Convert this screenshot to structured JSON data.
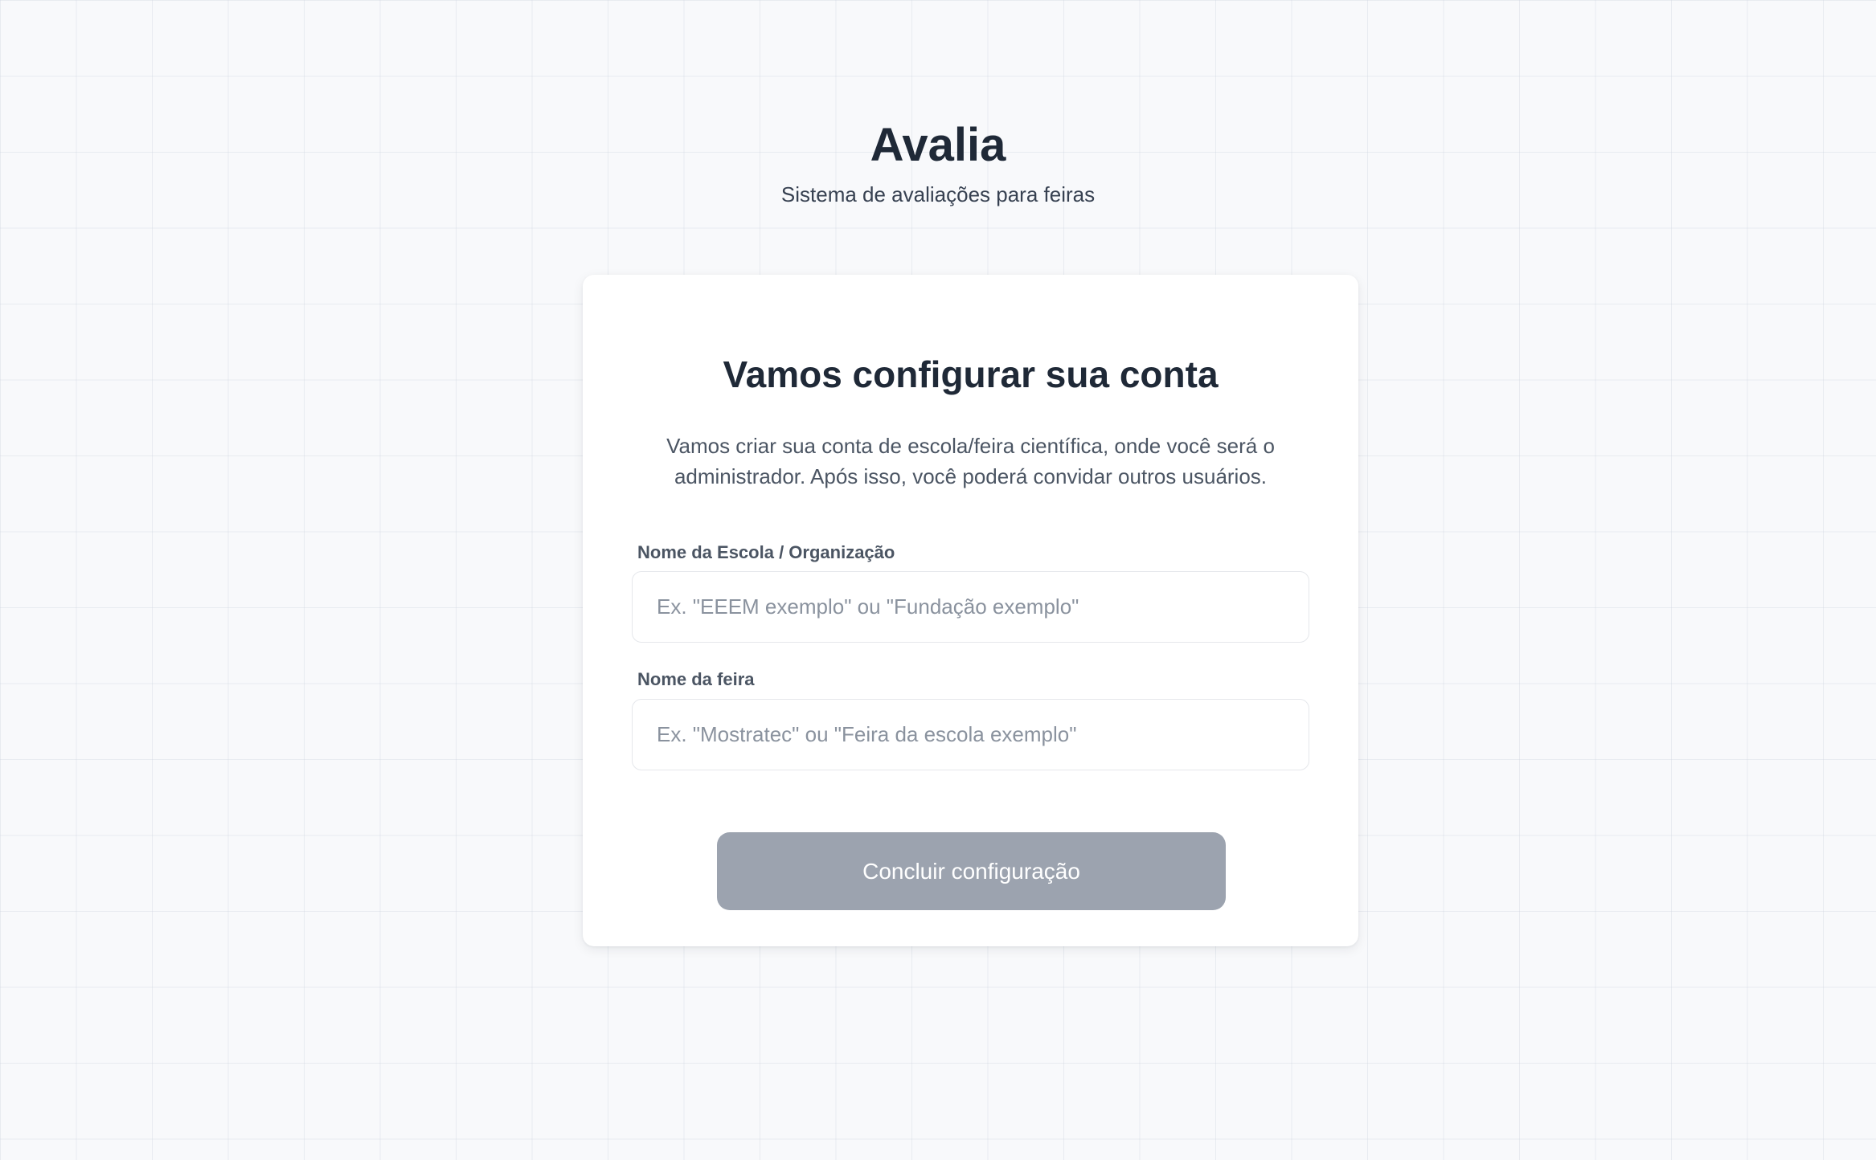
{
  "header": {
    "title": "Avalia",
    "subtitle": "Sistema de avaliações para feiras"
  },
  "setup_card": {
    "title": "Vamos configurar sua conta",
    "description": "Vamos criar sua conta de escola/feira científica, onde você será o administrador. Após isso, você poderá convidar outros usuários.",
    "school_field": {
      "label": "Nome da Escola / Organização",
      "placeholder": "Ex. \"EEEM exemplo\" ou \"Fundação exemplo\"",
      "value": ""
    },
    "fair_field": {
      "label": "Nome da feira",
      "placeholder": "Ex. \"Mostratec\" ou \"Feira da escola exemplo\"",
      "value": ""
    },
    "submit_label": "Concluir configuração"
  },
  "colors": {
    "background": "#f8f9fb",
    "card": "#ffffff",
    "title_text": "#1f2937",
    "muted_text": "#4b5563",
    "button_disabled": "#9ca3af"
  }
}
